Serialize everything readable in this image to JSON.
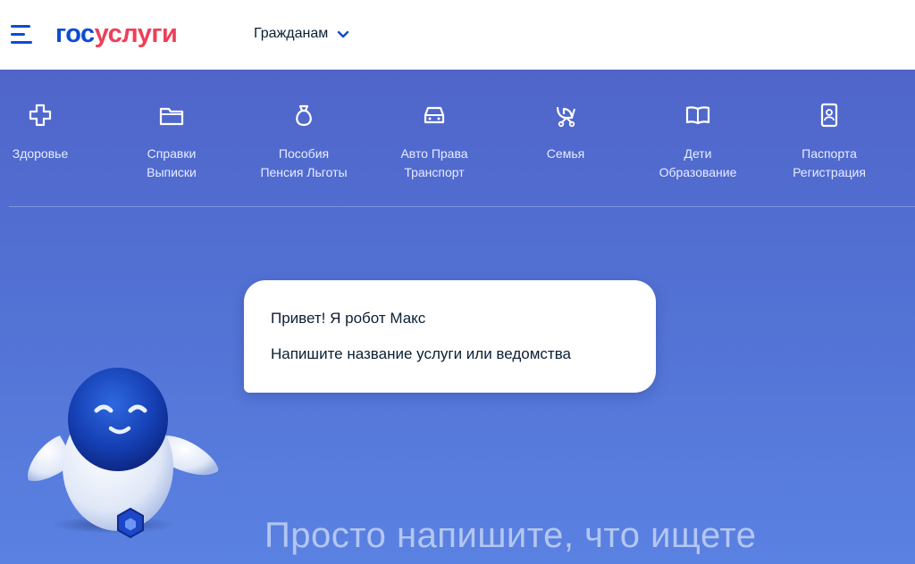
{
  "header": {
    "logo_part1": "гос",
    "logo_part2": "услуги",
    "role_label": "Гражданам",
    "menu_icon": "hamburger-menu-icon",
    "role_icon": "chevron-down-icon"
  },
  "categories": [
    {
      "icon": "health-plus-icon",
      "line1": "Здоровье",
      "line2": ""
    },
    {
      "icon": "folder-icon",
      "line1": "Справки",
      "line2": "Выписки"
    },
    {
      "icon": "money-bag-icon",
      "line1": "Пособия",
      "line2": "Пенсия Льготы"
    },
    {
      "icon": "car-icon",
      "line1": "Авто Права",
      "line2": "Транспорт"
    },
    {
      "icon": "baby-stroller-icon",
      "line1": "Семья",
      "line2": ""
    },
    {
      "icon": "open-book-icon",
      "line1": "Дети",
      "line2": "Образование"
    },
    {
      "icon": "passport-icon",
      "line1": "Паспорта",
      "line2": "Регистрация"
    }
  ],
  "chat": {
    "greeting": "Привет! Я робот Макс",
    "instruction": "Напишите название услуги или ведомства"
  },
  "prompt_text": "Просто напишите, что ищете",
  "colors": {
    "brand_blue": "#0d4cd3",
    "brand_red": "#ee3f58",
    "background_blue": "#5374d6",
    "text_dark": "#0b1f33"
  }
}
